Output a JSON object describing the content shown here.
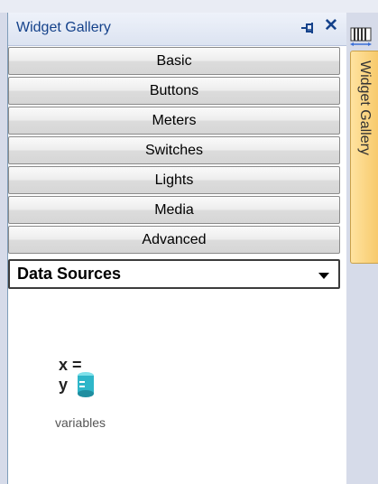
{
  "panel": {
    "title": "Widget Gallery",
    "pin_icon": "pin-icon",
    "close_icon": "close-icon",
    "close_glyph": "✕"
  },
  "categories": [
    {
      "label": "Basic"
    },
    {
      "label": "Buttons"
    },
    {
      "label": "Meters"
    },
    {
      "label": "Switches"
    },
    {
      "label": "Lights"
    },
    {
      "label": "Media"
    },
    {
      "label": "Advanced"
    }
  ],
  "selected_category": {
    "label": "Data Sources",
    "icon": "chevron-down-icon"
  },
  "widgets": [
    {
      "label": "variables",
      "icon": "variables-database-icon",
      "icon_text_x": "x =",
      "icon_text_y": "y ="
    }
  ],
  "side_tab": {
    "label": "Widget Gallery",
    "icon": "gallery-icon"
  },
  "colors": {
    "title_text": "#15428b",
    "tab_fill": "#f7c96a",
    "cylinder": "#2fb6c9"
  }
}
